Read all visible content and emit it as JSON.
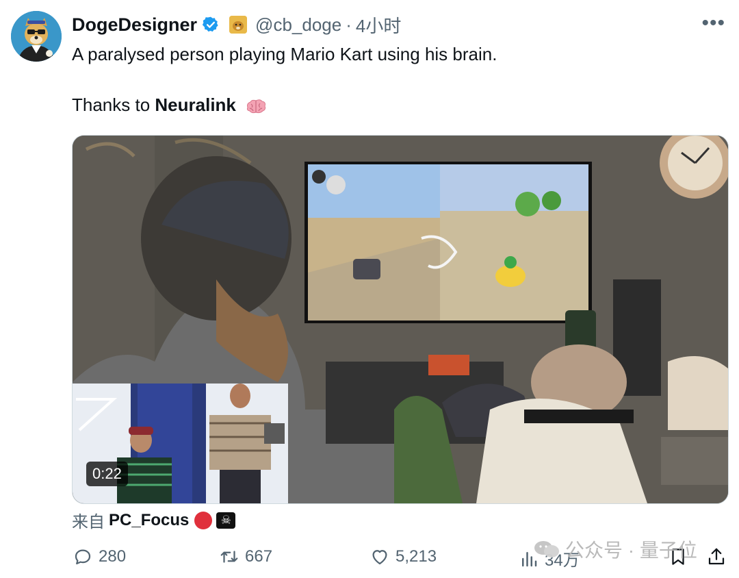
{
  "tweet": {
    "author": {
      "display_name": "DogeDesigner",
      "handle": "@cb_doge",
      "avatar_icon": "doge-avatar-icon",
      "verified_color": "#1d9bf0"
    },
    "separator": "·",
    "time": "4小时",
    "more_label": "•••",
    "text_line1": "A paralysed person playing Mario Kart using his brain.",
    "text_line2_prefix": "Thanks to ",
    "text_line2_bold": "Neuralink",
    "emoji": "brain-icon",
    "media": {
      "duration": "0:22"
    },
    "source": {
      "prefix": "来自",
      "name": "PC_Focus",
      "badges": [
        "red-circle-icon",
        "skull-icon"
      ]
    },
    "actions": {
      "replies": "280",
      "retweets": "667",
      "likes": "5,213",
      "views": "34万"
    }
  },
  "watermark": "公众号 · 量子位",
  "colors": {
    "text_primary": "#0f1419",
    "text_secondary": "#536471",
    "accent": "#1d9bf0"
  }
}
